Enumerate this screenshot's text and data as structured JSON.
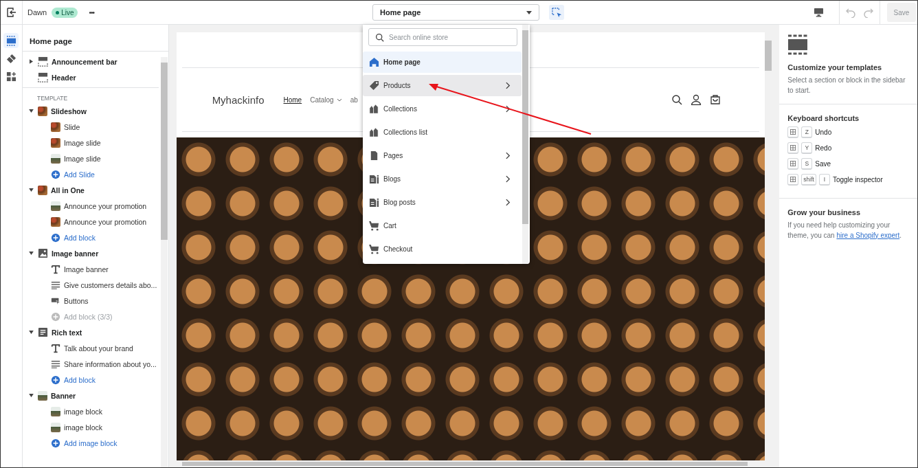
{
  "topbar": {
    "theme_name": "Dawn",
    "status_badge": "Live",
    "more_menu": "•••",
    "page_select": "Home page",
    "save_button": {
      "label": "Save",
      "disabled": true
    }
  },
  "rail": [
    {
      "kind": "sections",
      "selected": true
    },
    {
      "kind": "theme",
      "selected": false
    },
    {
      "kind": "apps",
      "selected": false
    }
  ],
  "sidebar": {
    "title": "Home page",
    "fixed_sections": [
      {
        "label": "Announcement bar",
        "kind": "collapsible"
      },
      {
        "label": "Header",
        "kind": "plain"
      }
    ],
    "template_label": "TEMPLATE",
    "sections": [
      {
        "label": "Slideshow",
        "kind": "photo",
        "expanded": true,
        "children": [
          {
            "label": "Slide",
            "kind": "photo",
            "disabled": false
          },
          {
            "label": "Image slide",
            "kind": "photo",
            "disabled": false
          },
          {
            "label": "Image slide",
            "kind": "landscape",
            "disabled": false
          },
          {
            "label": "Add Slide",
            "kind": "add",
            "disabled": false
          }
        ]
      },
      {
        "label": "All in One",
        "kind": "photo",
        "expanded": true,
        "children": [
          {
            "label": "Announce your promotion",
            "kind": "landscape",
            "disabled": false
          },
          {
            "label": "Announce your promotion",
            "kind": "photo",
            "disabled": false
          },
          {
            "label": "Add block",
            "kind": "add",
            "disabled": false
          }
        ]
      },
      {
        "label": "Image banner",
        "kind": "image",
        "expanded": true,
        "children": [
          {
            "label": "Image banner",
            "kind": "heading",
            "disabled": false
          },
          {
            "label": "Give customers details abo...",
            "kind": "paragraph",
            "disabled": false
          },
          {
            "label": "Buttons",
            "kind": "buttons",
            "disabled": false
          },
          {
            "label": "Add block (3/3)",
            "kind": "add",
            "disabled": true
          }
        ]
      },
      {
        "label": "Rich text",
        "kind": "text",
        "expanded": true,
        "children": [
          {
            "label": "Talk about your brand",
            "kind": "heading",
            "disabled": false
          },
          {
            "label": "Share information about yo...",
            "kind": "paragraph",
            "disabled": false
          },
          {
            "label": "Add block",
            "kind": "add",
            "disabled": false
          }
        ]
      },
      {
        "label": "Banner",
        "kind": "landscape",
        "expanded": true,
        "children": [
          {
            "label": "image block",
            "kind": "landscape",
            "disabled": false
          },
          {
            "label": "image block",
            "kind": "landscape",
            "disabled": false
          },
          {
            "label": "Add image block",
            "kind": "add",
            "disabled": false
          }
        ]
      }
    ]
  },
  "preview": {
    "store_name": "Myhackinfo",
    "nav": [
      {
        "label": "Home",
        "selected": true,
        "dropdown": false
      },
      {
        "label": "Catalog",
        "selected": false,
        "dropdown": true
      },
      {
        "label": "ab",
        "selected": false,
        "dropdown": false
      }
    ]
  },
  "page_menu": {
    "search": {
      "placeholder": "Search online store"
    },
    "items": [
      {
        "label": "Home page",
        "kind": "home",
        "selected": true,
        "hovered": false,
        "submenu": false
      },
      {
        "label": "Products",
        "kind": "tag",
        "selected": false,
        "hovered": true,
        "submenu": true
      },
      {
        "label": "Collections",
        "kind": "tags",
        "selected": false,
        "hovered": false,
        "submenu": true
      },
      {
        "label": "Collections list",
        "kind": "tags",
        "selected": false,
        "hovered": false,
        "submenu": false
      },
      {
        "label": "Pages",
        "kind": "page",
        "selected": false,
        "hovered": false,
        "submenu": true
      },
      {
        "label": "Blogs",
        "kind": "blog",
        "selected": false,
        "hovered": false,
        "submenu": true
      },
      {
        "label": "Blog posts",
        "kind": "blog",
        "selected": false,
        "hovered": false,
        "submenu": true
      },
      {
        "label": "Cart",
        "kind": "cart",
        "selected": false,
        "hovered": false,
        "submenu": false
      },
      {
        "label": "Checkout",
        "kind": "cart",
        "selected": false,
        "hovered": false,
        "submenu": false
      }
    ]
  },
  "right_panel": {
    "title": "Customize your templates",
    "description": "Select a section or block in the sidebar to start.",
    "shortcuts_title": "Keyboard shortcuts",
    "shortcuts": [
      {
        "keys": [
          "Z"
        ],
        "action": "Undo"
      },
      {
        "keys": [
          "Y"
        ],
        "action": "Redo"
      },
      {
        "keys": [
          "S"
        ],
        "action": "Save"
      },
      {
        "keys": [
          "shift",
          "I"
        ],
        "action": "Toggle inspector"
      }
    ],
    "grow_title": "Grow your business",
    "grow_text": "If you need help customizing your theme, you can",
    "grow_link": "hire a Shopify expert",
    "grow_end": "."
  }
}
